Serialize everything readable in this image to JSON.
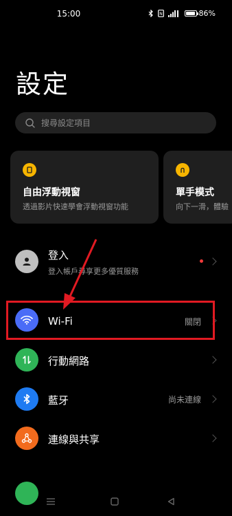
{
  "status_bar": {
    "time": "15:00",
    "battery": "86%",
    "icons": [
      "bluetooth-icon",
      "nfc-icon",
      "signal-icon",
      "battery-icon"
    ]
  },
  "page": {
    "title": "設定"
  },
  "search": {
    "placeholder": "搜尋設定項目"
  },
  "cards": [
    {
      "title": "自由浮動視窗",
      "subtitle": "透過影片快速學會浮動視窗功能",
      "icon": "floating-window-icon"
    },
    {
      "title": "單手模式",
      "subtitle": "向下一滑，體驗",
      "icon": "one-hand-icon"
    }
  ],
  "account": {
    "title": "登入",
    "subtitle": "登入帳戶尋享更多優質服務",
    "icon": "person-icon"
  },
  "rows": [
    {
      "label": "Wi-Fi",
      "value": "關閉",
      "icon": "wifi-icon",
      "color": "#4a6cf7"
    },
    {
      "label": "行動網路",
      "value": "",
      "icon": "mobile-data-icon",
      "color": "#2fb457"
    },
    {
      "label": "藍牙",
      "value": "尚未連線",
      "icon": "bluetooth-icon",
      "color": "#1e7bf2"
    },
    {
      "label": "連線與共享",
      "value": "",
      "icon": "share-icon",
      "color": "#f26b1d"
    }
  ],
  "colors": {
    "accent_yellow": "#f7b500",
    "annotation_red": "#e11a22",
    "notification_dot": "#f23a3a"
  }
}
